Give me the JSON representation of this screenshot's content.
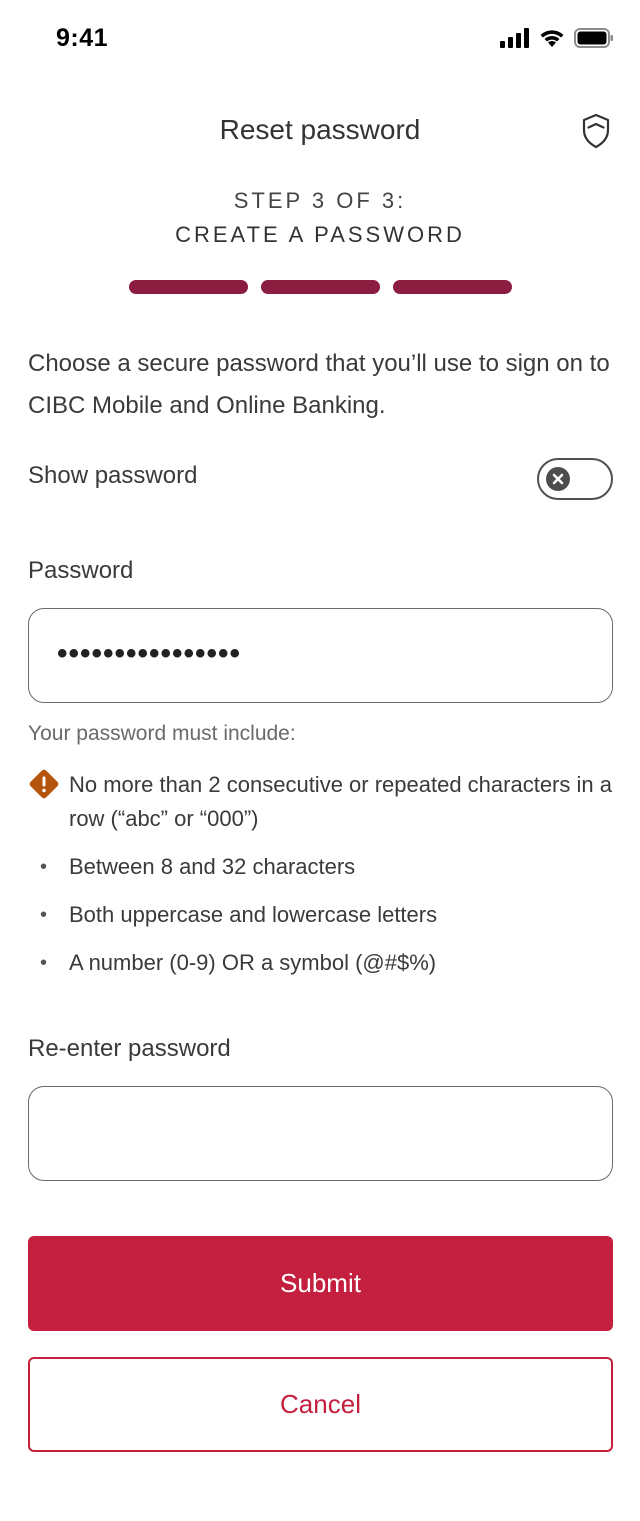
{
  "status_bar": {
    "time": "9:41"
  },
  "header": {
    "title": "Reset password",
    "icon": "shield-icon"
  },
  "step": {
    "label": "STEP 3 OF 3:",
    "title": "CREATE A PASSWORD",
    "completed": 3,
    "total": 3
  },
  "intro_text": "Choose a secure password that you’ll use to sign on to CIBC Mobile and Online Banking.",
  "show_password": {
    "label": "Show password",
    "enabled": false
  },
  "password": {
    "label": "Password",
    "masked_value": "••••••••••••••••"
  },
  "requirements": {
    "heading": "Your password must include:",
    "items": [
      {
        "text": "No more than 2 consecutive or repeated characters in a row (“abc” or “000”)",
        "status": "warning",
        "icon": "warning-icon"
      },
      {
        "text": "Between 8 and 32 characters",
        "status": "pending",
        "bullet": "•"
      },
      {
        "text": "Both uppercase and lowercase letters",
        "status": "pending",
        "bullet": "•"
      },
      {
        "text": "A number (0-9) OR a symbol (@#$%)",
        "status": "pending",
        "bullet": "•"
      }
    ]
  },
  "reenter_password": {
    "label": "Re-enter password",
    "value": ""
  },
  "buttons": {
    "submit": "Submit",
    "cancel": "Cancel"
  },
  "colors": {
    "brand": "#c41f3e",
    "progress": "#8b1d41",
    "warning": "#b5520c"
  }
}
